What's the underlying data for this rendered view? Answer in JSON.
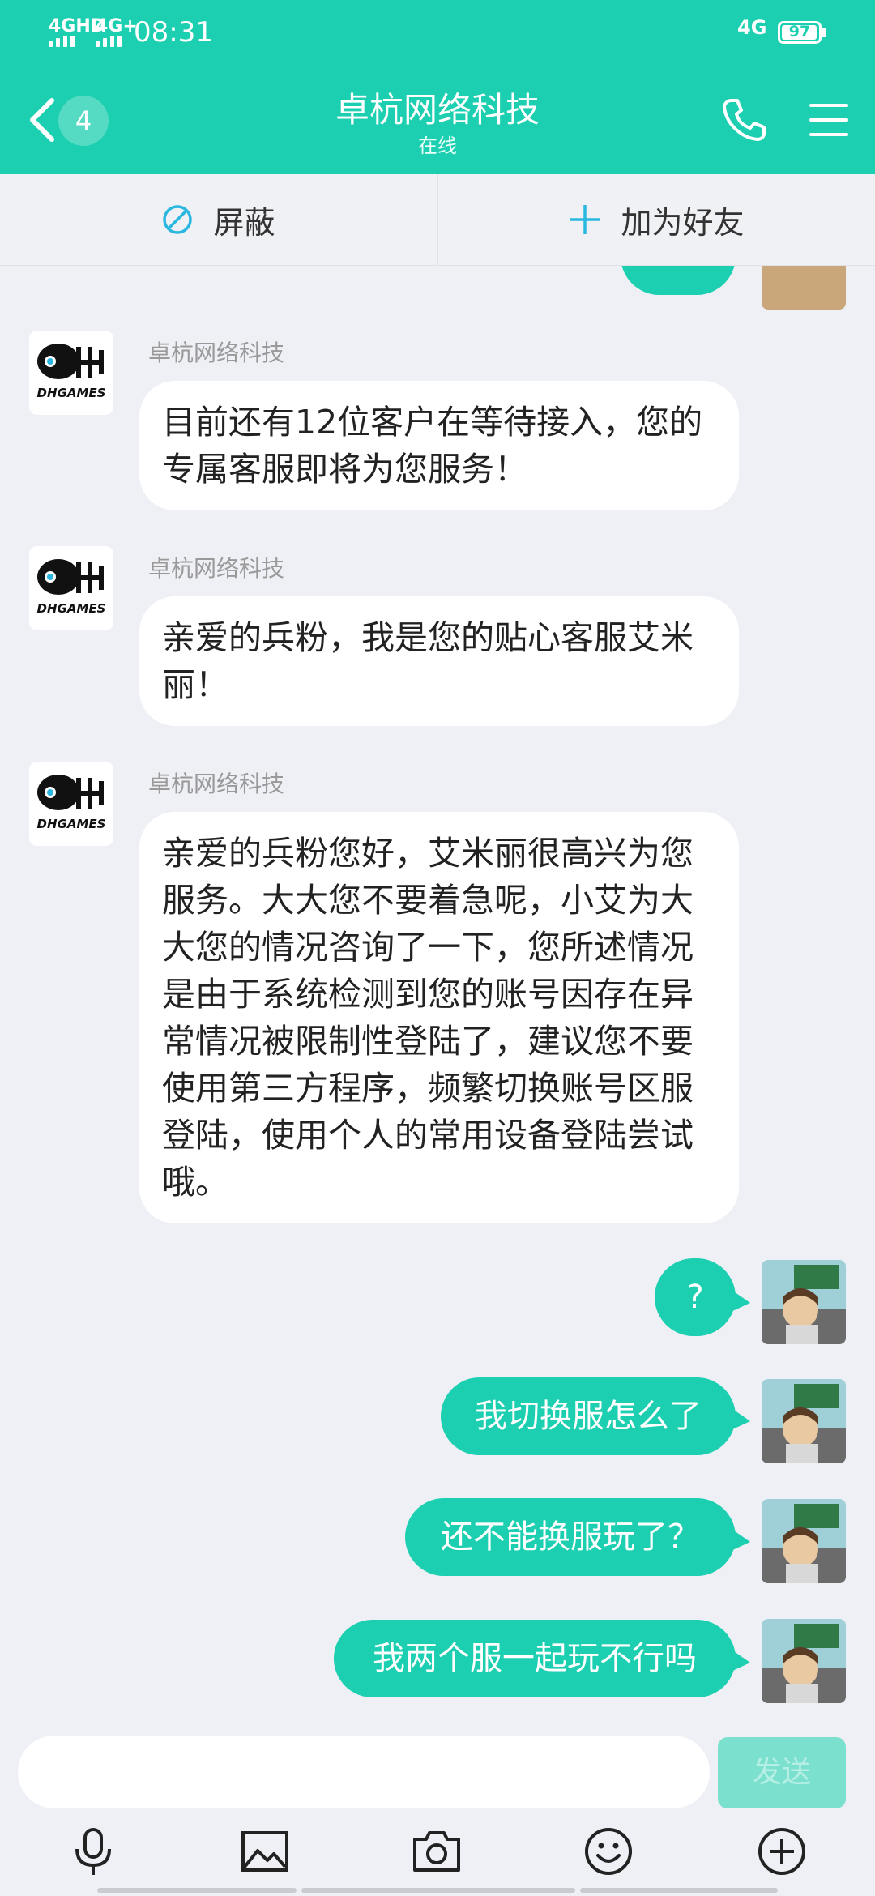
{
  "status_bar": {
    "signal1": "4GHD",
    "signal2": "4G+",
    "time": "08:31",
    "network_right": "4G",
    "battery": "97"
  },
  "header": {
    "back_count": "4",
    "title": "卓杭网络科技",
    "subtitle": "在线"
  },
  "actions": {
    "block_label": "屏蔽",
    "add_friend_label": "加为好友"
  },
  "messages": [
    {
      "side": "left",
      "sender": "卓杭网络科技",
      "avatar_text": "DHGAMES",
      "text": "目前还有12位客户在等待接入，您的专属客服即将为您服务！"
    },
    {
      "side": "left",
      "sender": "卓杭网络科技",
      "avatar_text": "DHGAMES",
      "text": "亲爱的兵粉，我是您的贴心客服艾米丽！"
    },
    {
      "side": "left",
      "sender": "卓杭网络科技",
      "avatar_text": "DHGAMES",
      "text": "亲爱的兵粉您好，艾米丽很高兴为您服务。大大您不要着急呢，小艾为大大您的情况咨询了一下，您所述情况是由于系统检测到您的账号因存在异常情况被限制性登陆了，建议您不要使用第三方程序，频繁切换账号区服登陆，使用个人的常用设备登陆尝试哦。"
    },
    {
      "side": "right",
      "text": "?"
    },
    {
      "side": "right",
      "text": "我切换服怎么了"
    },
    {
      "side": "right",
      "text": "还不能换服玩了？"
    },
    {
      "side": "right",
      "text": "我两个服一起玩不行吗"
    }
  ],
  "input": {
    "placeholder": "",
    "send_label": "发送"
  },
  "colors": {
    "accent": "#1ccfb0",
    "background": "#eef0f5"
  }
}
